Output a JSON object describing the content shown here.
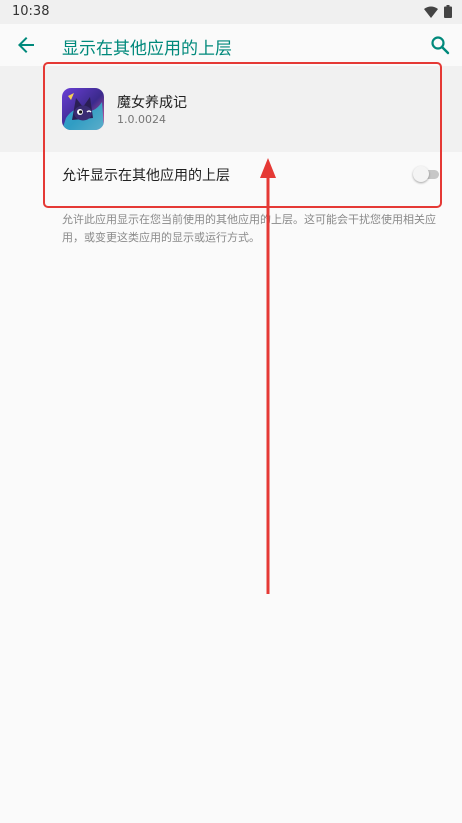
{
  "status_bar": {
    "time": "10:38",
    "icons": [
      "wifi-icon",
      "battery-icon"
    ]
  },
  "app_bar": {
    "title": "显示在其他应用的上层",
    "back_icon": "arrow-back-icon",
    "search_icon": "search-icon"
  },
  "app": {
    "name": "魔女养成记",
    "version": "1.0.0024"
  },
  "setting": {
    "label": "允许显示在其他应用的上层",
    "enabled": false
  },
  "description": "允许此应用显示在您当前使用的其他应用的上层。这可能会干扰您使用相关应用，或变更这类应用的显示或运行方式。",
  "colors": {
    "accent": "#00897b",
    "annotation": "#e53935"
  }
}
